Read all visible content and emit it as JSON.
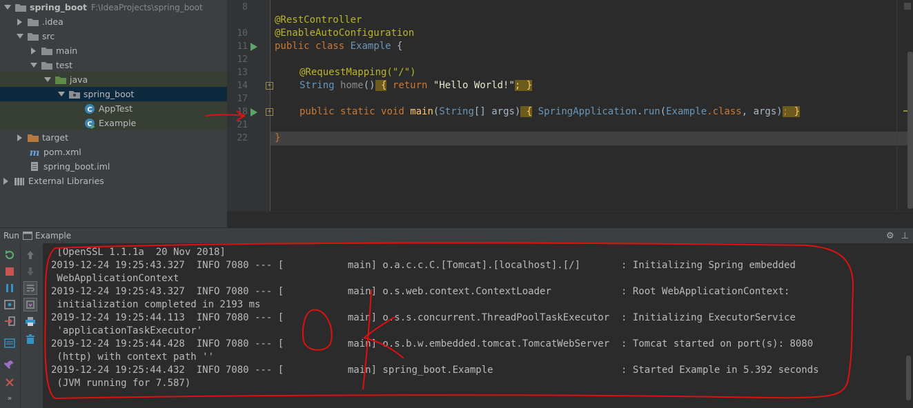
{
  "project_tree": {
    "root_label": "spring_boot",
    "root_path": "F:\\IdeaProjects\\spring_boot",
    "items": [
      {
        "label": ".idea"
      },
      {
        "label": "src"
      },
      {
        "label": "main"
      },
      {
        "label": "test"
      },
      {
        "label": "java"
      },
      {
        "label": "spring_boot"
      },
      {
        "label": "AppTest"
      },
      {
        "label": "Example"
      },
      {
        "label": "target"
      },
      {
        "label": "pom.xml"
      },
      {
        "label": "spring_boot.iml"
      },
      {
        "label": "External Libraries"
      }
    ]
  },
  "editor": {
    "line_numbers": [
      "8",
      "10",
      "11",
      "12",
      "13",
      "14",
      "16",
      "17",
      "18",
      "21",
      "22"
    ],
    "code": {
      "l10": "@RestController",
      "l11": "@EnableAutoConfiguration",
      "l12_kw1": "public",
      "l12_kw2": "class",
      "l12_name": "Example",
      "l12_brace": " {",
      "l13": "@RequestMapping(\"/\")",
      "l14_type": "String",
      "l14_name": "home",
      "l14_paren": "()",
      "l14_open": " {",
      "l14_ret": "return",
      "l14_str": "\"Hello World!\"",
      "l14_semi": ";",
      "l14_close": " }",
      "l18_kw1": "public",
      "l18_kw2": "static",
      "l18_kw3": "void",
      "l18_name": "main",
      "l18_params_open": "(",
      "l18_type": "String",
      "l18_params_rest": "[] args)",
      "l18_open": " {",
      "l18_app": "SpringApplication",
      "l18_dot": ".",
      "l18_run": "run",
      "l18_paren": "(",
      "l18_cls": "Example",
      "l18_dotclass": ".class",
      "l18_args": ", args)",
      "l18_semi": ";",
      "l18_close": " }",
      "l22": "}"
    }
  },
  "run_window": {
    "label": "Run",
    "tab": "Example",
    "console_lines": [
      " [OpenSSL 1.1.1a  20 Nov 2018]",
      "2019-12-24 19:25:43.327  INFO 7080 --- [           main] o.a.c.c.C.[Tomcat].[localhost].[/]       : Initializing Spring embedded",
      " WebApplicationContext",
      "2019-12-24 19:25:43.327  INFO 7080 --- [           main] o.s.web.context.ContextLoader            : Root WebApplicationContext:",
      " initialization completed in 2193 ms",
      "2019-12-24 19:25:44.113  INFO 7080 --- [           main] o.s.s.concurrent.ThreadPoolTaskExecutor  : Initializing ExecutorService",
      " 'applicationTaskExecutor'",
      "2019-12-24 19:25:44.428  INFO 7080 --- [           main] o.s.b.w.embedded.tomcat.TomcatWebServer  : Tomcat started on port(s): 8080",
      " (http) with context path ''",
      "2019-12-24 19:25:44.432  INFO 7080 --- [           main] spring_boot.Example                      : Started Example in 5.392 seconds",
      " (JVM running for 7.587)"
    ]
  },
  "colors": {
    "annotation_red": "#e01010",
    "keyword": "#cc7832",
    "string": "#6a8759",
    "type": "#6897bb",
    "annotation": "#bbb529"
  }
}
